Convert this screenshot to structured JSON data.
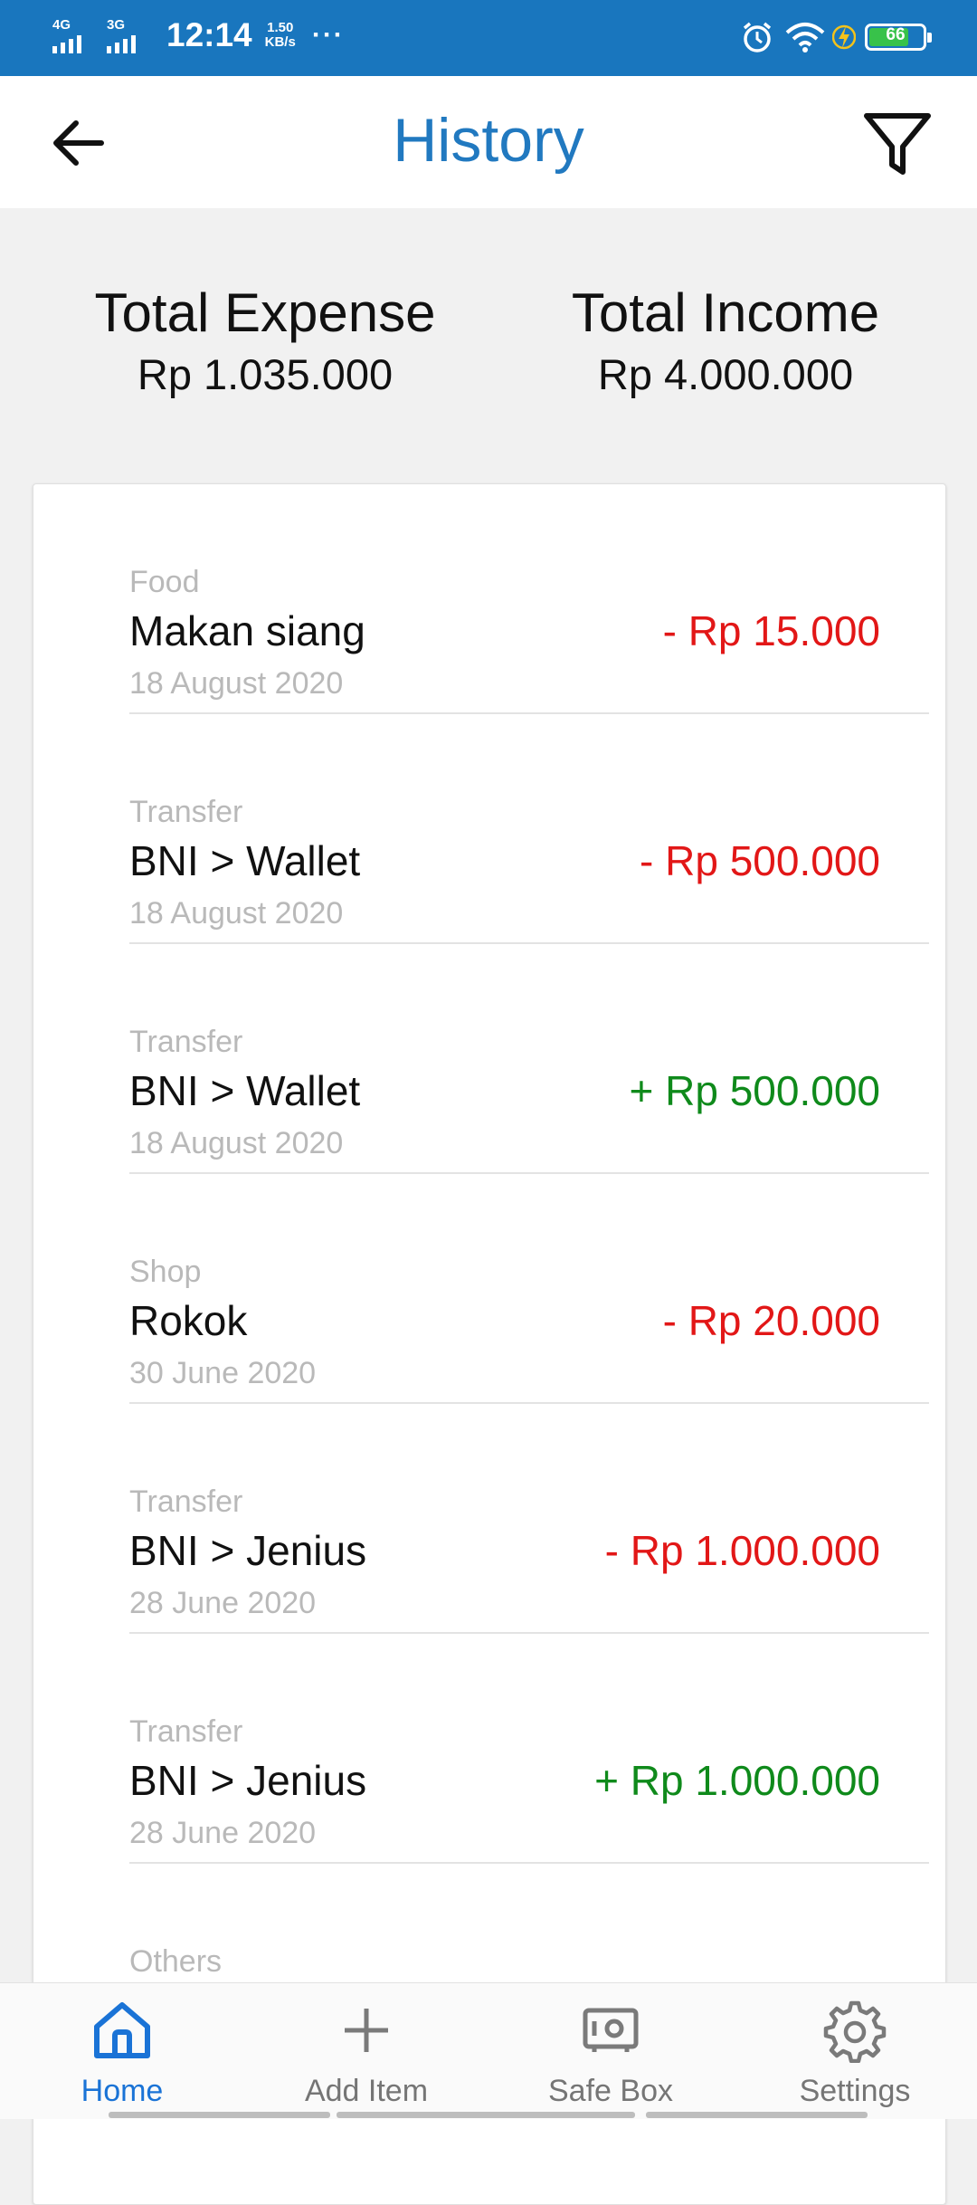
{
  "status_bar": {
    "network1": "4G",
    "network2": "3G",
    "time": "12:14",
    "speed_value": "1.50",
    "speed_unit": "KB/s",
    "more": "···",
    "battery": "66",
    "icons": [
      "alarm-icon",
      "wifi-icon",
      "charging-icon",
      "battery-icon"
    ]
  },
  "header": {
    "title": "History",
    "back_icon": "arrow-left-icon",
    "filter_icon": "filter-icon"
  },
  "summary": {
    "expense_label": "Total Expense",
    "expense_value": "Rp 1.035.000",
    "income_label": "Total Income",
    "income_value": "Rp 4.000.000"
  },
  "transactions": [
    {
      "category": "Food",
      "name": "Makan siang",
      "date": "18 August 2020",
      "amount": "- Rp 15.000",
      "type": "expense"
    },
    {
      "category": "Transfer",
      "name": "BNI > Wallet",
      "date": "18 August 2020",
      "amount": "- Rp 500.000",
      "type": "expense"
    },
    {
      "category": "Transfer",
      "name": "BNI > Wallet",
      "date": "18 August 2020",
      "amount": "+ Rp 500.000",
      "type": "income"
    },
    {
      "category": "Shop",
      "name": "Rokok",
      "date": "30 June 2020",
      "amount": "- Rp 20.000",
      "type": "expense"
    },
    {
      "category": "Transfer",
      "name": "BNI > Jenius",
      "date": "28 June 2020",
      "amount": "- Rp 1.000.000",
      "type": "expense"
    },
    {
      "category": "Transfer",
      "name": "BNI > Jenius",
      "date": "28 June 2020",
      "amount": "+ Rp 1.000.000",
      "type": "income"
    },
    {
      "category": "Others",
      "name": "",
      "date": "",
      "amount": "",
      "type": "expense"
    }
  ],
  "bottom_nav": [
    {
      "label": "Home",
      "icon": "home-icon",
      "active": true
    },
    {
      "label": "Add Item",
      "icon": "plus-icon",
      "active": false
    },
    {
      "label": "Safe Box",
      "icon": "safe-box-icon",
      "active": false
    },
    {
      "label": "Settings",
      "icon": "gear-icon",
      "active": false
    }
  ],
  "colors": {
    "status_bar": "#1976be",
    "title": "#2179c0",
    "expense": "#e21717",
    "income": "#0f8a1b",
    "active_nav": "#1a73d6",
    "background": "#f1f1f1"
  }
}
